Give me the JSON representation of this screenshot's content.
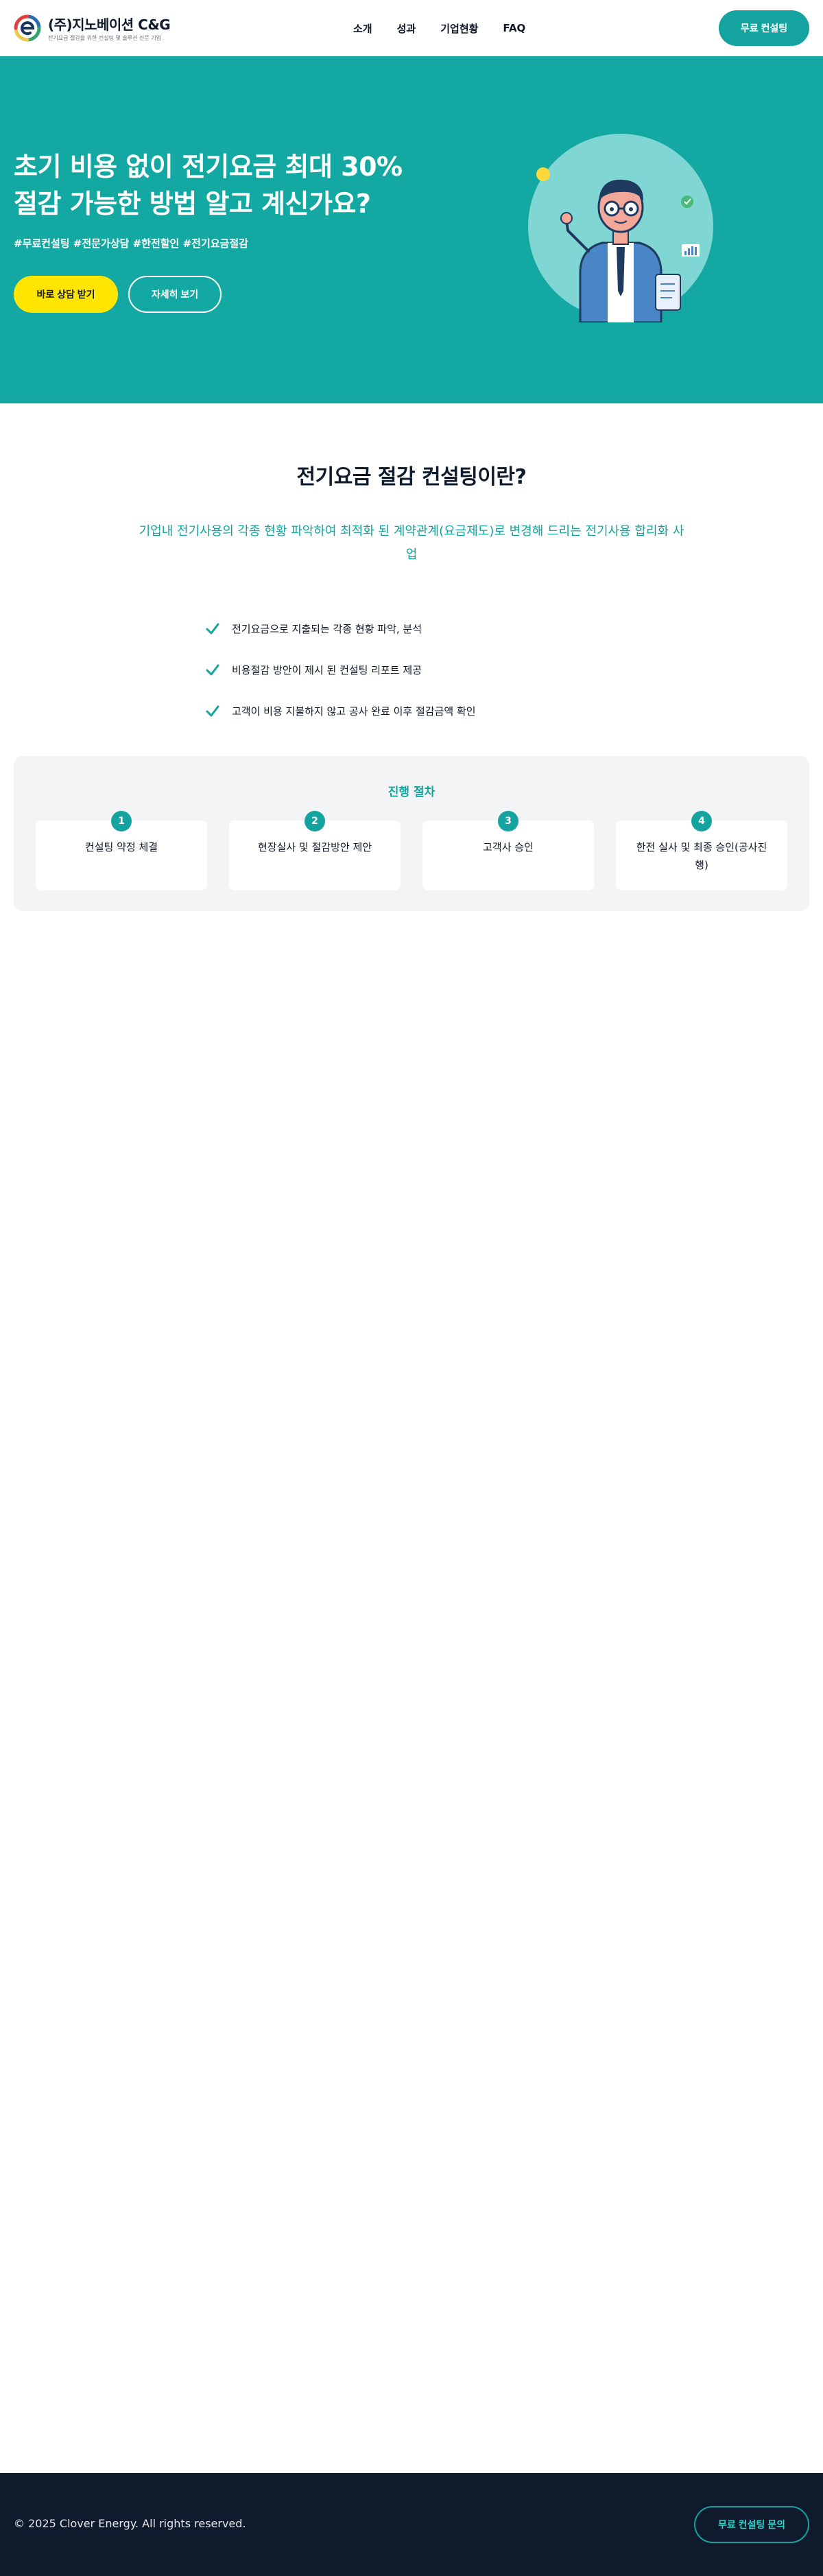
{
  "header": {
    "logo_title": "(주)지노베이션 C&G",
    "logo_subtitle": "전기요금 절감을 위한 컨설팅 및 솔루션 전문 기업",
    "nav": [
      "소개",
      "성과",
      "기업현황",
      "FAQ"
    ],
    "cta_label": "무료 컨설팅"
  },
  "hero": {
    "title_line1": "초기 비용 없이 전기요금 최대 30%",
    "title_line2": "절감 가능한 방법 알고 계신가요?",
    "tags": "#무료컨설팅 #전문가상담 #한전할인 #전기요금절감",
    "primary_button": "바로 상담 받기",
    "secondary_button": "자세히 보기"
  },
  "intro": {
    "title": "전기요금 절감 컨설팅이란?",
    "description": "기업내 전기사용의 각종 현황 파악하여 최적화 된 계약관계(요금제도)로 변경해 드리는 전기사용 합리화 사업",
    "checklist": [
      "전기요금으로 지출되는 각종 현황 파악, 분석",
      "비용절감 방안이 제시 된 컨설팅 리포트 제공",
      "고객이 비용 지불하지 않고 공사 완료 이후 절감금액 확인"
    ]
  },
  "process": {
    "title": "진행 절차",
    "steps": [
      {
        "num": "1",
        "label": "컨설팅 약정 체결"
      },
      {
        "num": "2",
        "label": "현장실사 및 절감방안 제안"
      },
      {
        "num": "3",
        "label": "고객사 승인"
      },
      {
        "num": "4",
        "label": "한전 실사 및 최종 승인(공사진행)"
      }
    ]
  },
  "footer": {
    "copyright": "© 2025 Clover Energy. All rights reserved.",
    "cta_label": "무료 컨설팅 문의"
  },
  "colors": {
    "brand": "#14a39e",
    "hero_bg": "#14a8a2",
    "highlight": "#ffe500",
    "footer_bg": "#0f1b2d"
  }
}
